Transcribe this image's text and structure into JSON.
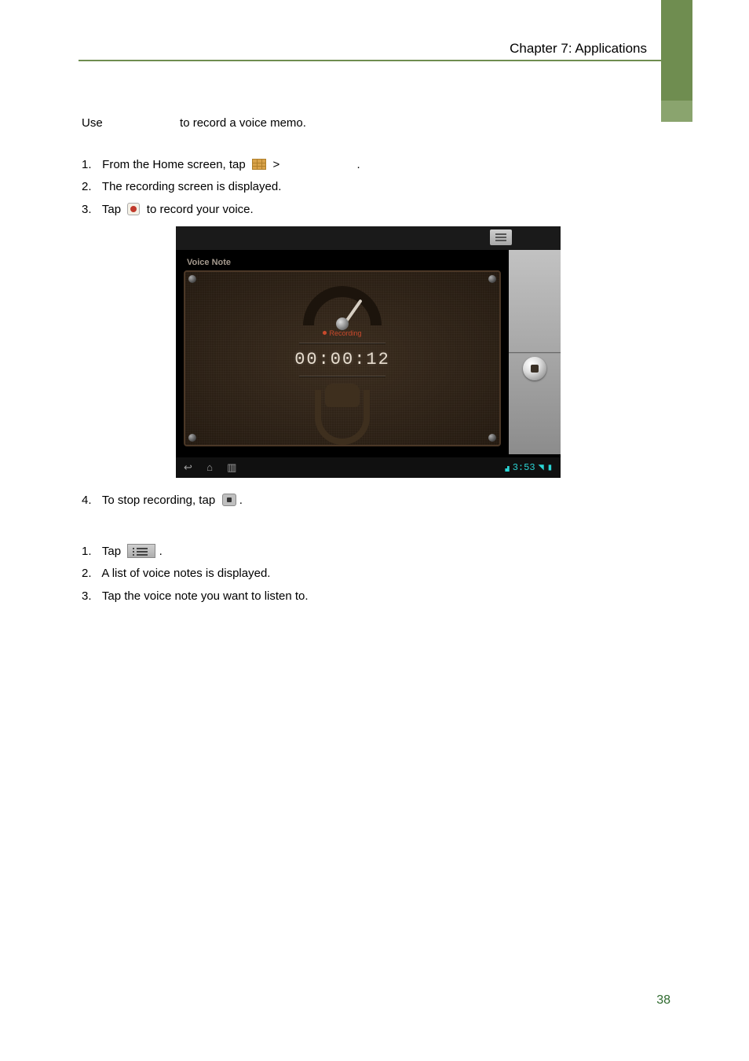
{
  "header": {
    "chapter": "Chapter 7: Applications"
  },
  "intro": {
    "prefix": "Use",
    "suffix": "to record a voice memo."
  },
  "record_steps": [
    {
      "n": "1.",
      "pre": "From the Home screen, tap",
      "mid": ">",
      "post": "."
    },
    {
      "n": "2.",
      "text": "The recording screen is displayed."
    },
    {
      "n": "3.",
      "pre": "Tap",
      "post": "to record your voice."
    },
    {
      "n": "4.",
      "pre": "To stop recording, tap",
      "post": "."
    }
  ],
  "play_steps": [
    {
      "n": "1.",
      "pre": "Tap",
      "post": "."
    },
    {
      "n": "2.",
      "text": "A list of voice notes is displayed."
    },
    {
      "n": "3.",
      "text": "Tap the voice note you want to listen to."
    }
  ],
  "screenshot": {
    "title": "Voice Note",
    "status": "Recording",
    "timer": "00:00:12",
    "clock": "3:53"
  },
  "page_number": "38"
}
